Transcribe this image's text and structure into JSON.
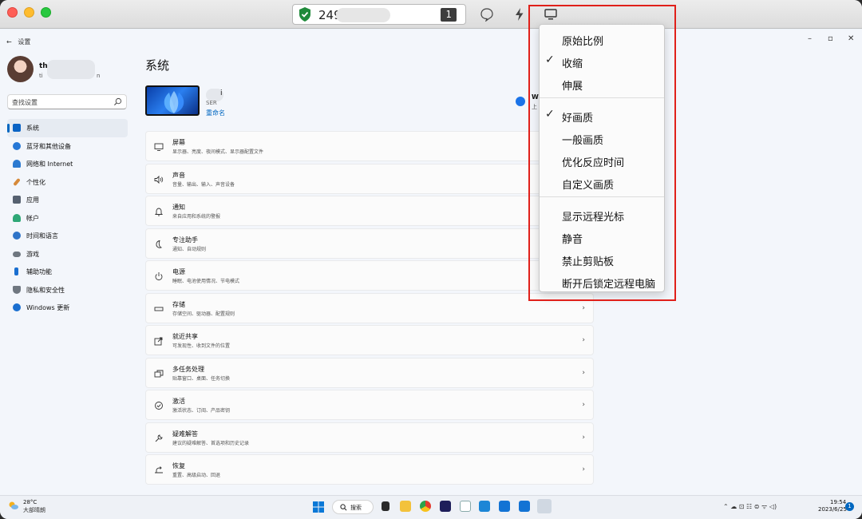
{
  "remote_toolbar": {
    "connection_id": "249",
    "screen_number": "1",
    "icons": [
      "shield-check-icon",
      "chat-icon",
      "lightning-icon",
      "display-icon"
    ]
  },
  "display_menu": {
    "items": [
      {
        "label": "原始比例",
        "checked": false
      },
      {
        "label": "收缩",
        "checked": true
      },
      {
        "label": "伸展",
        "checked": false
      },
      {
        "label": "好画质",
        "checked": true
      },
      {
        "label": "一般画质",
        "checked": false
      },
      {
        "label": "优化反应时间",
        "checked": false
      },
      {
        "label": "自定义画质",
        "checked": false
      },
      {
        "label": "显示远程光标",
        "checked": false
      },
      {
        "label": "静音",
        "checked": false
      },
      {
        "label": "禁止剪贴板",
        "checked": false
      },
      {
        "label": "断开后锁定远程电脑",
        "checked": false
      }
    ],
    "checkmark": "✓"
  },
  "settings": {
    "back_label": "设置",
    "window_controls": {
      "minimize": "–",
      "maximize": "▫",
      "close": "✕"
    },
    "user": {
      "name": "th",
      "email_start": "ti",
      "email_end": "n"
    },
    "search_placeholder": "查找设置",
    "nav": [
      {
        "label": "系统",
        "icon": "display-icon",
        "color": "#0a63c4",
        "active": true
      },
      {
        "label": "蓝牙和其他设备",
        "icon": "bluetooth-icon",
        "color": "#2577d6"
      },
      {
        "label": "网络和 Internet",
        "icon": "wifi-icon",
        "color": "#2c7ad0"
      },
      {
        "label": "个性化",
        "icon": "brush-icon",
        "color": "#d68a3a"
      },
      {
        "label": "应用",
        "icon": "apps-icon",
        "color": "#566170"
      },
      {
        "label": "帐户",
        "icon": "person-icon",
        "color": "#2ea776"
      },
      {
        "label": "时间和语言",
        "icon": "globe-clock-icon",
        "color": "#2f74c8"
      },
      {
        "label": "游戏",
        "icon": "gamepad-icon",
        "color": "#6f7780"
      },
      {
        "label": "辅助功能",
        "icon": "accessibility-icon",
        "color": "#1a6fd0"
      },
      {
        "label": "隐私和安全性",
        "icon": "shield-icon",
        "color": "#6f7780"
      },
      {
        "label": "Windows 更新",
        "icon": "update-icon",
        "color": "#1a6fd0"
      }
    ],
    "page_title": "系统",
    "device": {
      "name_tail": "i",
      "sub": "SER",
      "rename": "重命名"
    },
    "ms365": {
      "title": "W",
      "sub": "上"
    },
    "cards": [
      {
        "title": "屏幕",
        "sub": "显示器、亮度、夜间模式、显示器配置文件",
        "icon": "monitor-icon"
      },
      {
        "title": "声音",
        "sub": "音量、输出、输入、声音设备",
        "icon": "speaker-icon"
      },
      {
        "title": "通知",
        "sub": "来自应用和系统的警报",
        "icon": "bell-icon"
      },
      {
        "title": "专注助手",
        "sub": "通知、自动规则",
        "icon": "moon-icon"
      },
      {
        "title": "电源",
        "sub": "睡眠、电池使用情况、节电模式",
        "icon": "power-icon"
      },
      {
        "title": "存储",
        "sub": "存储空间、驱动器、配置规则",
        "icon": "storage-icon"
      },
      {
        "title": "就近共享",
        "sub": "可发现性、收到文件的位置",
        "icon": "share-icon"
      },
      {
        "title": "多任务处理",
        "sub": "贴靠窗口、桌面、任务切换",
        "icon": "multitask-icon"
      },
      {
        "title": "激活",
        "sub": "激活状态、订阅、产品密钥",
        "icon": "check-circle-icon"
      },
      {
        "title": "疑难解答",
        "sub": "建议的疑难解答、首选项和历史记录",
        "icon": "wrench-icon"
      },
      {
        "title": "恢复",
        "sub": "重置、高级启动、回退",
        "icon": "recovery-icon"
      }
    ],
    "chevron": "›"
  },
  "taskbar": {
    "weather_temp": "28°C",
    "weather_desc": "大部晴朗",
    "search_label": "搜索",
    "time": "19:54",
    "date": "2023/6/25",
    "notification_count": "1",
    "tray_text": "⌃ ☁ ⊡ ☷ ⊜ ᯤ ◁)"
  }
}
